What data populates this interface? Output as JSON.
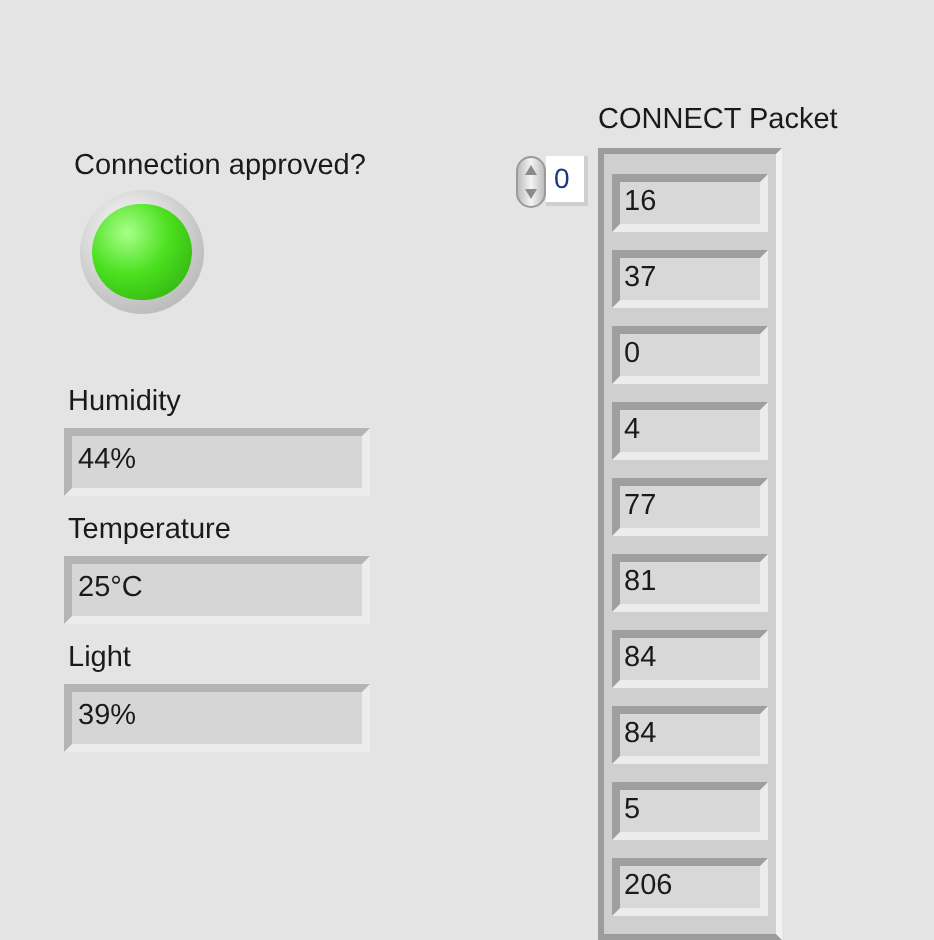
{
  "connection": {
    "label": "Connection approved?",
    "on": true
  },
  "indicators": [
    {
      "label": "Humidity",
      "value": "44%"
    },
    {
      "label": "Temperature",
      "value": "25°C"
    },
    {
      "label": "Light",
      "value": "39%"
    }
  ],
  "packet": {
    "label": "CONNECT Packet",
    "index": "0",
    "elements": [
      "16",
      "37",
      "0",
      "4",
      "77",
      "81",
      "84",
      "84",
      "5",
      "206"
    ]
  }
}
